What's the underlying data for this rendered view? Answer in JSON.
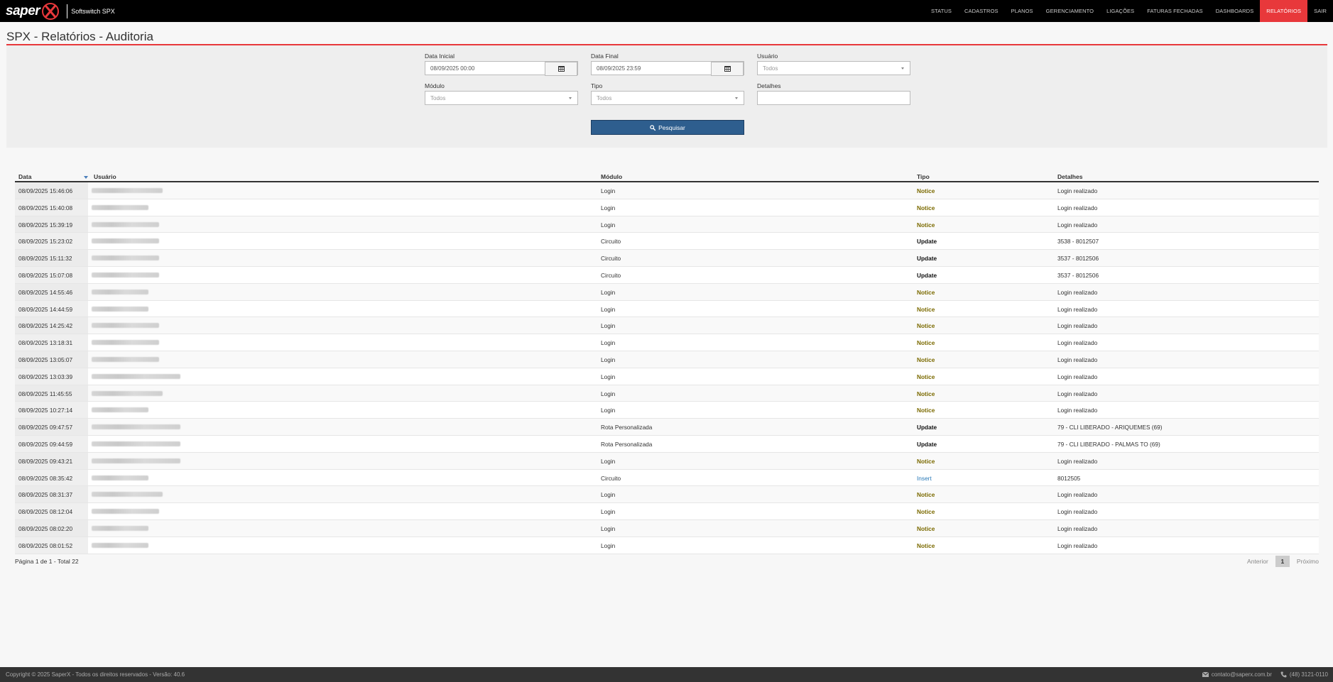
{
  "app": {
    "logo_text": "saper",
    "subtitle": "Softswitch SPX"
  },
  "nav": [
    {
      "label": "STATUS"
    },
    {
      "label": "CADASTROS"
    },
    {
      "label": "PLANOS"
    },
    {
      "label": "GERENCIAMENTO"
    },
    {
      "label": "LIGAÇÕES"
    },
    {
      "label": "FATURAS FECHADAS"
    },
    {
      "label": "DASHBOARDS"
    },
    {
      "label": "RELATÓRIOS",
      "active": true
    },
    {
      "label": "SAIR"
    }
  ],
  "page": {
    "title": "SPX - Relatórios - Auditoria"
  },
  "filters": {
    "data_inicial": {
      "label": "Data Inicial",
      "value": "08/09/2025 00:00"
    },
    "data_final": {
      "label": "Data Final",
      "value": "08/09/2025 23:59"
    },
    "usuario": {
      "label": "Usuário",
      "value": "Todos"
    },
    "modulo": {
      "label": "Módulo",
      "value": "Todos"
    },
    "tipo": {
      "label": "Tipo",
      "value": "Todos"
    },
    "detalhes": {
      "label": "Detalhes",
      "value": ""
    },
    "search_label": "Pesquisar"
  },
  "table": {
    "columns": [
      "Data",
      "Usuário",
      "Módulo",
      "Tipo",
      "Detalhes"
    ],
    "rows": [
      {
        "data": "08/09/2025 15:46:06",
        "modulo": "Login",
        "tipo": "Notice",
        "detalhes": "Login realizado"
      },
      {
        "data": "08/09/2025 15:40:08",
        "modulo": "Login",
        "tipo": "Notice",
        "detalhes": "Login realizado"
      },
      {
        "data": "08/09/2025 15:39:19",
        "modulo": "Login",
        "tipo": "Notice",
        "detalhes": "Login realizado"
      },
      {
        "data": "08/09/2025 15:23:02",
        "modulo": "Circuito",
        "tipo": "Update",
        "detalhes": "3538 - 8012507"
      },
      {
        "data": "08/09/2025 15:11:32",
        "modulo": "Circuito",
        "tipo": "Update",
        "detalhes": "3537 - 8012506"
      },
      {
        "data": "08/09/2025 15:07:08",
        "modulo": "Circuito",
        "tipo": "Update",
        "detalhes": "3537 - 8012506"
      },
      {
        "data": "08/09/2025 14:55:46",
        "modulo": "Login",
        "tipo": "Notice",
        "detalhes": "Login realizado"
      },
      {
        "data": "08/09/2025 14:44:59",
        "modulo": "Login",
        "tipo": "Notice",
        "detalhes": "Login realizado"
      },
      {
        "data": "08/09/2025 14:25:42",
        "modulo": "Login",
        "tipo": "Notice",
        "detalhes": "Login realizado"
      },
      {
        "data": "08/09/2025 13:18:31",
        "modulo": "Login",
        "tipo": "Notice",
        "detalhes": "Login realizado"
      },
      {
        "data": "08/09/2025 13:05:07",
        "modulo": "Login",
        "tipo": "Notice",
        "detalhes": "Login realizado"
      },
      {
        "data": "08/09/2025 13:03:39",
        "modulo": "Login",
        "tipo": "Notice",
        "detalhes": "Login realizado"
      },
      {
        "data": "08/09/2025 11:45:55",
        "modulo": "Login",
        "tipo": "Notice",
        "detalhes": "Login realizado"
      },
      {
        "data": "08/09/2025 10:27:14",
        "modulo": "Login",
        "tipo": "Notice",
        "detalhes": "Login realizado"
      },
      {
        "data": "08/09/2025 09:47:57",
        "modulo": "Rota Personalizada",
        "tipo": "Update",
        "detalhes": "79 - CLI LIBERADO - ARIQUEMES (69)"
      },
      {
        "data": "08/09/2025 09:44:59",
        "modulo": "Rota Personalizada",
        "tipo": "Update",
        "detalhes": "79 - CLI LIBERADO - PALMAS TO (69)"
      },
      {
        "data": "08/09/2025 09:43:21",
        "modulo": "Login",
        "tipo": "Notice",
        "detalhes": "Login realizado"
      },
      {
        "data": "08/09/2025 08:35:42",
        "modulo": "Circuito",
        "tipo": "Insert",
        "detalhes": "8012505"
      },
      {
        "data": "08/09/2025 08:31:37",
        "modulo": "Login",
        "tipo": "Notice",
        "detalhes": "Login realizado"
      },
      {
        "data": "08/09/2025 08:12:04",
        "modulo": "Login",
        "tipo": "Notice",
        "detalhes": "Login realizado"
      },
      {
        "data": "08/09/2025 08:02:20",
        "modulo": "Login",
        "tipo": "Notice",
        "detalhes": "Login realizado"
      },
      {
        "data": "08/09/2025 08:01:52",
        "modulo": "Login",
        "tipo": "Notice",
        "detalhes": "Login realizado"
      }
    ]
  },
  "pagination": {
    "info": "Página 1 de 1 - Total 22",
    "prev": "Anterior",
    "current": "1",
    "next": "Próximo"
  },
  "footer": {
    "copyright": "Copyright © 2025 SaperX - Todos os direitos reservados - Versão: 40.6",
    "email": "contato@saperx.com.br",
    "phone": "(48) 3121-0110"
  },
  "colors": {
    "accent": "#e8383b",
    "primary_button": "#2e5e8e",
    "notice": "#7b6a00",
    "insert": "#2a7ab8"
  }
}
